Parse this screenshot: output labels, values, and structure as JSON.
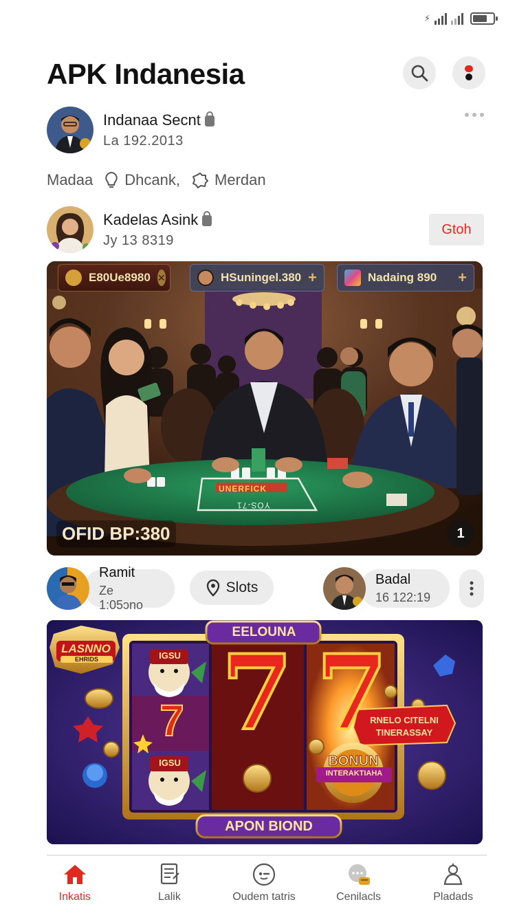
{
  "status_bar": {
    "battery_level": 0.75,
    "signal_bars": 4
  },
  "header": {
    "title": "APK Indanesia"
  },
  "posts": [
    {
      "name": "Indanaa Secnt",
      "date": "La 192.2013"
    },
    {
      "name": "Kadelas Asink",
      "date": "Jy 13 8319",
      "action": "Gtoh"
    }
  ],
  "tags": [
    "Madaa",
    "Dhcank,",
    "Merdan"
  ],
  "hero": {
    "chips": [
      {
        "label": "E80Ue8980",
        "action": "✕"
      },
      {
        "label": "HSuningel.380",
        "action": "+"
      },
      {
        "label": "Nadaing 890",
        "action": "+"
      }
    ],
    "caption": "OFID BP:380",
    "table_text": "UNERFICK",
    "table_text_2": "YOS-71",
    "count": "1"
  },
  "stories": [
    {
      "name": "Ramit",
      "time": "Ze 1:05ɔno"
    },
    {
      "label": "Slots"
    },
    {
      "name": "Badal",
      "time": "16 122:19"
    }
  ],
  "banner": {
    "top_label": "EELOUNA",
    "logo_top": "LASNNO",
    "logo_bottom": "EHRIDS",
    "seven": "7",
    "promo_line1": "RNELO CITELNI",
    "promo_line2": "TINERASSAY",
    "bonus_line1": "BONUN",
    "bonus_line2": "INTERAKTIAHA",
    "slot_badge": "IGSU",
    "bottom_label": "APON BIOND"
  },
  "nav": [
    {
      "label": "Inkatis",
      "icon": "home-icon",
      "active": true
    },
    {
      "label": "Lalik",
      "icon": "document-icon",
      "active": false
    },
    {
      "label": "Oudem tatris",
      "icon": "chat-icon",
      "active": false
    },
    {
      "label": "Cenilacls",
      "icon": "coin-chat-icon",
      "active": false
    },
    {
      "label": "Pladads",
      "icon": "profile-icon",
      "active": false
    }
  ],
  "colors": {
    "accent": "#e02a1f",
    "pill_bg": "#ececec",
    "felt": "#1f7a4a"
  }
}
